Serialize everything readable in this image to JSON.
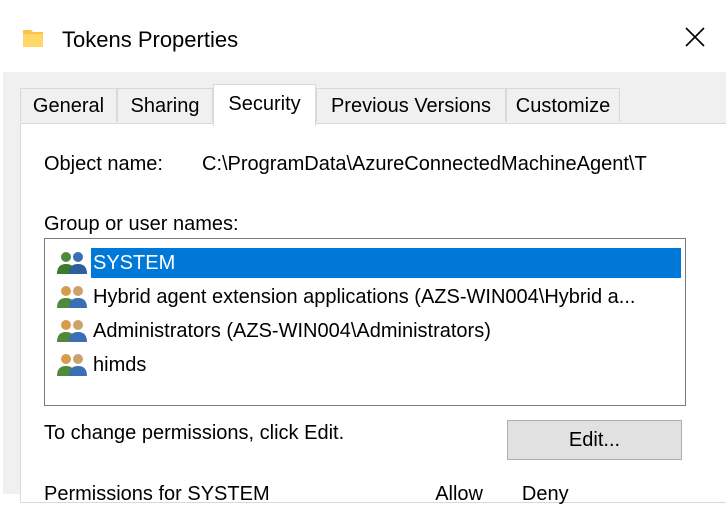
{
  "window": {
    "title": "Tokens Properties",
    "close_glyph": "✕"
  },
  "tabs": [
    {
      "label": "General"
    },
    {
      "label": "Sharing"
    },
    {
      "label": "Security",
      "active": true
    },
    {
      "label": "Previous Versions"
    },
    {
      "label": "Customize"
    }
  ],
  "security": {
    "object_name_label": "Object name:",
    "object_name_value": "C:\\ProgramData\\AzureConnectedMachineAgent\\T",
    "group_label": "Group or user names:",
    "users": [
      {
        "name": "SYSTEM",
        "selected": true,
        "icon": "users-icon"
      },
      {
        "name": "Hybrid agent extension applications (AZS-WIN004\\Hybrid a...",
        "selected": false,
        "icon": "users-icon"
      },
      {
        "name": "Administrators (AZS-WIN004\\Administrators)",
        "selected": false,
        "icon": "users-icon"
      },
      {
        "name": "himds",
        "selected": false,
        "icon": "users-icon"
      }
    ],
    "change_permissions_text": "To change permissions, click Edit.",
    "edit_button_label": "Edit...",
    "permissions_for_partial": "Permissions for SYSTEM                              Allow       Deny"
  },
  "colors": {
    "selection": "#0078d7",
    "window_bg": "#f0f0f0",
    "panel_bg": "#ffffff"
  }
}
